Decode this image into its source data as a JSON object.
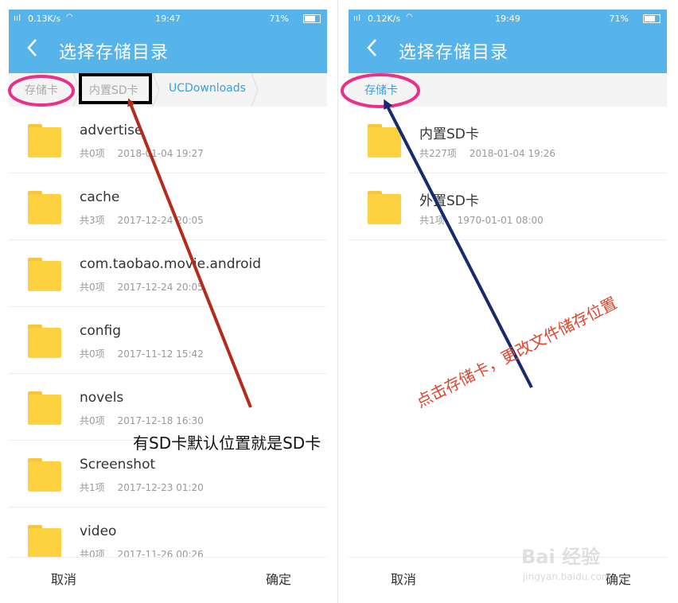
{
  "left": {
    "status": {
      "signal": "ııl",
      "speed": "0.13K/s",
      "time": "19:47",
      "battery": "71%"
    },
    "title": "选择存储目录",
    "breadcrumbs": [
      "存储卡",
      "内置SD卡",
      "UCDownloads"
    ],
    "items": [
      {
        "name": "advertise",
        "count": "共0项",
        "date": "2018-01-04 19:27"
      },
      {
        "name": "cache",
        "count": "共3项",
        "date": "2017-12-24 20:05"
      },
      {
        "name": "com.taobao.movie.android",
        "count": "共0项",
        "date": "2017-12-24 20:05"
      },
      {
        "name": "config",
        "count": "共0项",
        "date": "2017-11-12 15:42"
      },
      {
        "name": "novels",
        "count": "共0项",
        "date": "2017-12-18 16:30"
      },
      {
        "name": "Screenshot",
        "count": "共1项",
        "date": "2017-12-23 01:20"
      },
      {
        "name": "video",
        "count": "共0项",
        "date": "2017-11-26 00:26"
      }
    ],
    "footer": {
      "cancel": "取消",
      "ok": "确定"
    }
  },
  "right": {
    "status": {
      "signal": "ııl",
      "speed": "0.12K/s",
      "time": "19:49",
      "battery": "71%"
    },
    "title": "选择存储目录",
    "breadcrumbs": [
      "存储卡"
    ],
    "items": [
      {
        "name": "内置SD卡",
        "count": "共227项",
        "date": "2018-01-04 19:26"
      },
      {
        "name": "外置SD卡",
        "count": "共1项",
        "date": "1970-01-01 08:00"
      }
    ],
    "footer": {
      "cancel": "取消",
      "ok": "确定"
    }
  },
  "annotations": {
    "left_note": "有SD卡默认位置就是SD卡",
    "right_note": "点击存储卡，更改文件储存位置",
    "colors": {
      "pink_circle": "#e8318a",
      "black_box": "#000000",
      "red_arrow": "#b52a1d",
      "navy_arrow": "#162a6e",
      "header_blue": "#56b4ea",
      "folder_yellow": "#fdd13f"
    }
  },
  "watermark": {
    "main": "Bai 经验",
    "sub": "jingyan.baidu.com"
  }
}
